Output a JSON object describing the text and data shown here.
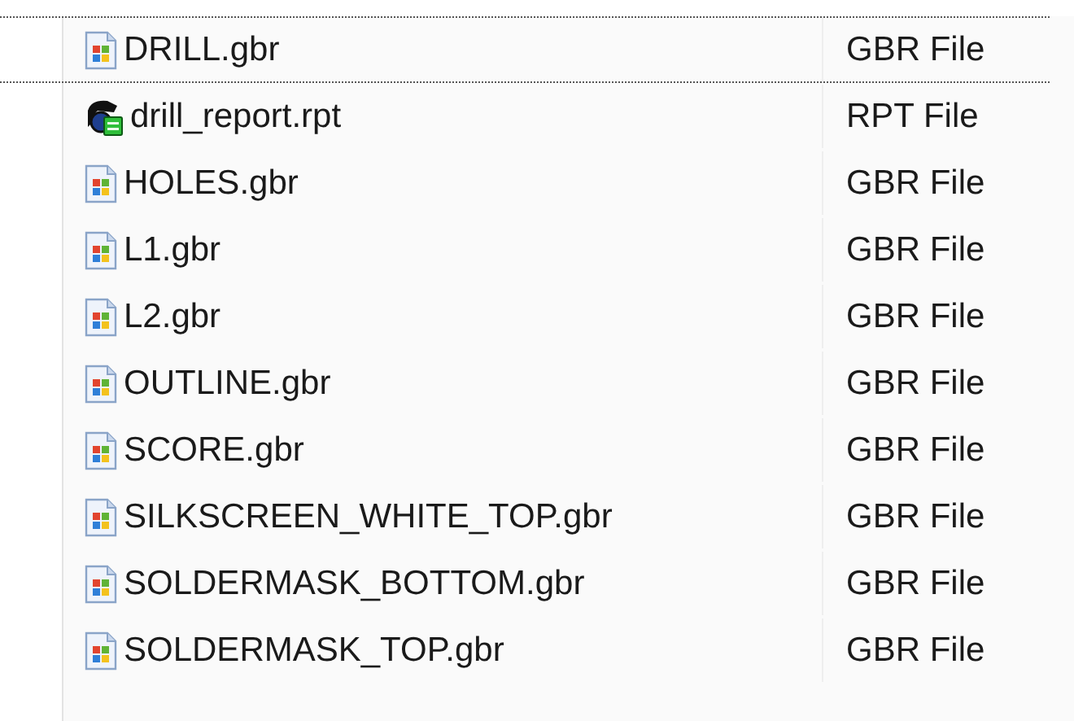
{
  "files": [
    {
      "name": "DRILL.gbr",
      "type": "GBR File",
      "kind": "gbr",
      "selected": true
    },
    {
      "name": "drill_report.rpt",
      "type": "RPT File",
      "kind": "report",
      "selected": false
    },
    {
      "name": "HOLES.gbr",
      "type": "GBR File",
      "kind": "gbr",
      "selected": false
    },
    {
      "name": "L1.gbr",
      "type": "GBR File",
      "kind": "gbr",
      "selected": false
    },
    {
      "name": "L2.gbr",
      "type": "GBR File",
      "kind": "gbr",
      "selected": false
    },
    {
      "name": "OUTLINE.gbr",
      "type": "GBR File",
      "kind": "gbr",
      "selected": false
    },
    {
      "name": "SCORE.gbr",
      "type": "GBR File",
      "kind": "gbr",
      "selected": false
    },
    {
      "name": "SILKSCREEN_WHITE_TOP.gbr",
      "type": "GBR File",
      "kind": "gbr",
      "selected": false
    },
    {
      "name": "SOLDERMASK_BOTTOM.gbr",
      "type": "GBR File",
      "kind": "gbr",
      "selected": false
    },
    {
      "name": "SOLDERMASK_TOP.gbr",
      "type": "GBR File",
      "kind": "gbr",
      "selected": false
    }
  ]
}
